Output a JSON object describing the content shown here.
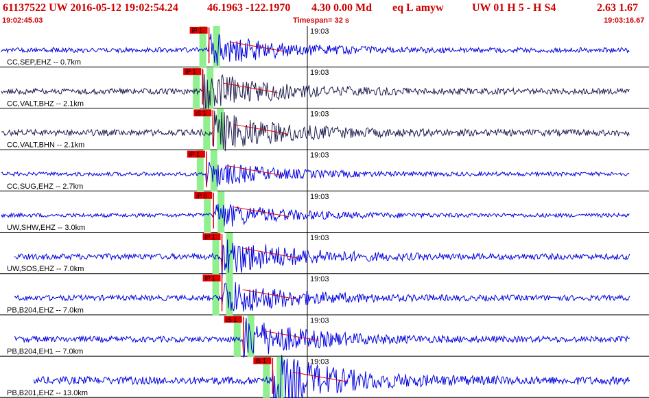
{
  "header": {
    "event_id": "61137522 UW 2016-05-12 19:02:54.24",
    "location": "46.1963 -122.1970",
    "depth_mag": "4.30  0.00 Md",
    "etype": "eq  L amyw",
    "network_info": "UW 01  H   5  -  H S4",
    "quality": "2.63  1.67",
    "start_time": "19:02:45.03",
    "timespan": "Timespan=  32 s",
    "end_time": "19:03:16.67"
  },
  "colors": {
    "header_text": "#d00000",
    "trace_blue": "#0000e0",
    "trace_dark": "#202050",
    "pick_red": "#e00000",
    "pick_window": "#90f090",
    "grid": "#000000"
  },
  "traces": [
    {
      "label": "CC,SEP,EHZ -- 0.7km",
      "time_mark": "19:03",
      "color": "blue",
      "picks": [
        {
          "label": "iP 1",
          "pos": 0.322
        }
      ],
      "amp": 10,
      "start": 0.0
    },
    {
      "label": "CC,VALT,BHZ -- 2.1km",
      "time_mark": "19:03",
      "color": "dark",
      "picks": [
        {
          "label": "iP 1",
          "pos": 0.312
        }
      ],
      "amp": 12,
      "start": 0.0
    },
    {
      "label": "CC,VALT,BHN -- 2.1km",
      "time_mark": "19:03",
      "color": "dark",
      "picks": [
        {
          "label": "iS 1",
          "pos": 0.328
        }
      ],
      "amp": 13,
      "start": 0.0
    },
    {
      "label": "CC,SUG,EHZ -- 2.7km",
      "time_mark": "19:03",
      "color": "blue",
      "picks": [
        {
          "label": "iP 1",
          "pos": 0.318
        }
      ],
      "amp": 8,
      "start": 0.0
    },
    {
      "label": "UW,SHW,EHZ -- 3.0km",
      "time_mark": "19:03",
      "color": "blue",
      "picks": [
        {
          "label": "iP 0",
          "pos": 0.329
        }
      ],
      "amp": 8,
      "start": 0.0
    },
    {
      "label": "UW,SOS,EHZ -- 7.0km",
      "time_mark": "19:03",
      "color": "blue",
      "picks": [
        {
          "label": "iP 1",
          "pos": 0.342
        }
      ],
      "amp": 12,
      "start": 0.02
    },
    {
      "label": "PB,B204,EHZ -- 7.0km",
      "time_mark": "19:03",
      "color": "blue",
      "picks": [
        {
          "label": "iP 1",
          "pos": 0.342
        }
      ],
      "amp": 11,
      "start": 0.02
    },
    {
      "label": "PB,B204,EH1 -- 7.0km",
      "time_mark": "19:03",
      "color": "blue",
      "picks": [
        {
          "label": "iS 1",
          "pos": 0.375
        }
      ],
      "amp": 12,
      "start": 0.02
    },
    {
      "label": "PB,B201,EHZ -- 13.0km",
      "time_mark": "19:03",
      "color": "blue",
      "picks": [
        {
          "label": "iS 1",
          "pos": 0.42
        }
      ],
      "amp": 16,
      "start": 0.05
    }
  ]
}
